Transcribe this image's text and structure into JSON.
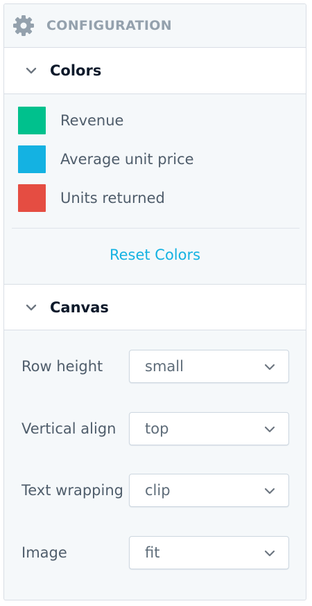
{
  "config": {
    "title": "CONFIGURATION",
    "icon": "gear-icon"
  },
  "colors_section": {
    "title": "Colors",
    "items": [
      {
        "label": "Revenue",
        "color": "#00c18d"
      },
      {
        "label": "Average unit price",
        "color": "#14b2e2"
      },
      {
        "label": "Units returned",
        "color": "#e54d42"
      }
    ],
    "reset_label": "Reset Colors"
  },
  "canvas_section": {
    "title": "Canvas",
    "rows": [
      {
        "label": "Row height",
        "value": "small"
      },
      {
        "label": "Vertical align",
        "value": "top"
      },
      {
        "label": "Text wrapping",
        "value": "clip"
      },
      {
        "label": "Image",
        "value": "fit"
      }
    ]
  },
  "colors_palette": {
    "accent": "#14b2e2",
    "muted_text": "#94a1ad",
    "border": "#d9dee5"
  }
}
